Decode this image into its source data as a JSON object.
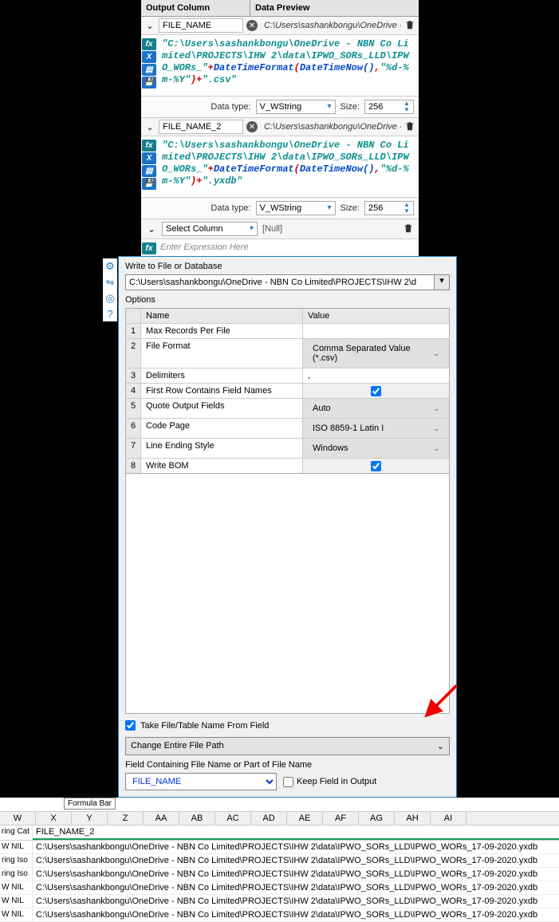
{
  "formula_panel": {
    "headers": {
      "output": "Output Column",
      "preview": "Data Preview"
    },
    "rows": [
      {
        "field": "FILE_NAME",
        "preview": "C:\\Users\\sashankbongu\\OneDrive - ...",
        "expr_parts": [
          "\"C:\\Users\\sashankbongu\\OneDrive - NBN Co Limited\\PROJECTS\\IHW 2\\data\\IPWO_SORs_LLD\\IPWO_WORs_\"",
          "+",
          "DateTimeFormat",
          "(",
          "DateTimeNow",
          "()",
          ",",
          "\"%d-%m-%Y\"",
          ")",
          "+",
          "\".csv\""
        ],
        "data_type_label": "Data type:",
        "data_type": "V_WString",
        "size_label": "Size:",
        "size": "256"
      },
      {
        "field": "FILE_NAME_2",
        "preview": "C:\\Users\\sashankbongu\\OneDrive - ...",
        "expr_parts": [
          "\"C:\\Users\\sashankbongu\\OneDrive - NBN Co Limited\\PROJECTS\\IHW 2\\data\\IPWO_SORs_LLD\\IPWO_WORs_\"",
          "+",
          "DateTimeFormat",
          "(",
          "DateTimeNow",
          "()",
          ",",
          "\"%d-%m-%Y\"",
          ")",
          "+",
          "\".yxdb\""
        ],
        "data_type_label": "Data type:",
        "data_type": "V_WString",
        "size_label": "Size:",
        "size": "256"
      }
    ],
    "select_column": "Select Column",
    "null": "[Null]",
    "enter_expr": "Enter Expression Here"
  },
  "output_panel": {
    "title": "Write to File or Database",
    "path": "C:\\Users\\sashankbongu\\OneDrive - NBN Co Limited\\PROJECTS\\IHW 2\\d",
    "options_label": "Options",
    "columns": {
      "name": "Name",
      "value": "Value"
    },
    "options": [
      {
        "n": "1",
        "name": "Max Records Per File",
        "value": "",
        "type": "text"
      },
      {
        "n": "2",
        "name": "File Format",
        "value": "Comma Separated Value (*.csv)",
        "type": "dropdown"
      },
      {
        "n": "3",
        "name": "Delimiters",
        "value": ",",
        "type": "text"
      },
      {
        "n": "4",
        "name": "First Row Contains Field Names",
        "value": "true",
        "type": "check"
      },
      {
        "n": "5",
        "name": "Quote Output Fields",
        "value": "Auto",
        "type": "dropdown"
      },
      {
        "n": "6",
        "name": "Code Page",
        "value": "ISO 8859-1 Latin I",
        "type": "dropdown"
      },
      {
        "n": "7",
        "name": "Line Ending Style",
        "value": "Windows",
        "type": "dropdown"
      },
      {
        "n": "8",
        "name": "Write BOM",
        "value": "true",
        "type": "check"
      }
    ],
    "take_label": "Take File/Table Name From Field",
    "take_checked": true,
    "change_label": "Change Entire File Path",
    "field_label": "Field Containing File Name or Part of File Name",
    "field_value": "FILE_NAME",
    "keep_label": "Keep Field in Output",
    "keep_checked": false
  },
  "tooltip": "Formula Bar",
  "excel": {
    "cols": [
      "W",
      "X",
      "Y",
      "Z",
      "AA",
      "AB",
      "AC",
      "AD",
      "AE",
      "AF",
      "AG",
      "AH",
      "AI"
    ],
    "header_c0": "ring Cat",
    "header_c1": "FILE_NAME_2",
    "rows": [
      {
        "c0": "W NIL",
        "c1": "C:\\Users\\sashankbongu\\OneDrive - NBN Co Limited\\PROJECTS\\IHW 2\\data\\IPWO_SORs_LLD\\IPWO_WORs_17-09-2020.yxdb"
      },
      {
        "c0": "ring Iso",
        "c1": "C:\\Users\\sashankbongu\\OneDrive - NBN Co Limited\\PROJECTS\\IHW 2\\data\\IPWO_SORs_LLD\\IPWO_WORs_17-09-2020.yxdb"
      },
      {
        "c0": "ring Iso",
        "c1": "C:\\Users\\sashankbongu\\OneDrive - NBN Co Limited\\PROJECTS\\IHW 2\\data\\IPWO_SORs_LLD\\IPWO_WORs_17-09-2020.yxdb"
      },
      {
        "c0": "W NIL",
        "c1": "C:\\Users\\sashankbongu\\OneDrive - NBN Co Limited\\PROJECTS\\IHW 2\\data\\IPWO_SORs_LLD\\IPWO_WORs_17-09-2020.yxdb"
      },
      {
        "c0": "W NIL",
        "c1": "C:\\Users\\sashankbongu\\OneDrive - NBN Co Limited\\PROJECTS\\IHW 2\\data\\IPWO_SORs_LLD\\IPWO_WORs_17-09-2020.yxdb"
      },
      {
        "c0": "W NIL",
        "c1": "C:\\Users\\sashankbongu\\OneDrive - NBN Co Limited\\PROJECTS\\IHW 2\\data\\IPWO_SORs_LLD\\IPWO_WORs_17-09-2020.yxdb"
      }
    ]
  }
}
